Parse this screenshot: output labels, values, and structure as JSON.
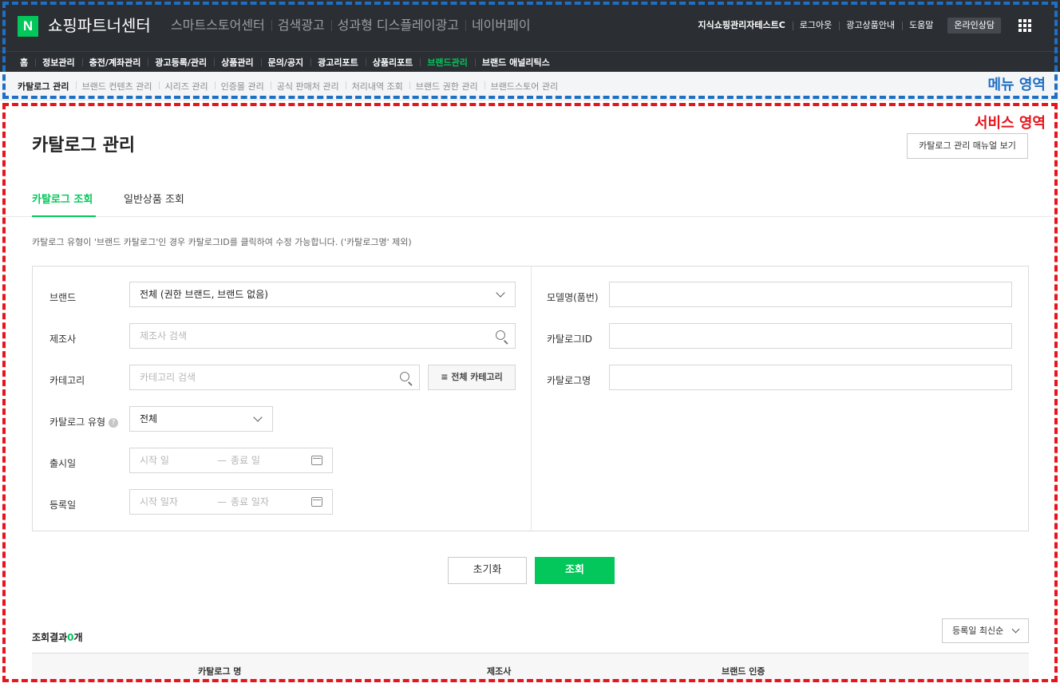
{
  "header": {
    "logo_mark": "N",
    "logo_text": "쇼핑파트너센터",
    "links": [
      "스마트스토어센터",
      "검색광고",
      "성과형 디스플레이광고",
      "네이버페이"
    ],
    "user": "지식쇼핑관리자테스트C",
    "user_links": [
      "로그아웃",
      "광고상품안내",
      "도움말"
    ],
    "consult": "온라인상담"
  },
  "main_menu": [
    {
      "label": "홈"
    },
    {
      "label": "정보관리"
    },
    {
      "label": "충전/계좌관리"
    },
    {
      "label": "광고등록/관리"
    },
    {
      "label": "상품관리"
    },
    {
      "label": "문의/공지"
    },
    {
      "label": "광고리포트"
    },
    {
      "label": "상품리포트"
    },
    {
      "label": "브랜드관리"
    },
    {
      "label": "브랜드 애널리틱스"
    }
  ],
  "sub_menu": [
    {
      "label": "카탈로그 관리"
    },
    {
      "label": "브랜드 컨텐츠 관리"
    },
    {
      "label": "시리즈 관리"
    },
    {
      "label": "인증몰 관리"
    },
    {
      "label": "공식 판매처 관리"
    },
    {
      "label": "처리내역 조회"
    },
    {
      "label": "브랜드 권한 관리"
    },
    {
      "label": "브랜드스토어 관리"
    }
  ],
  "annotations": {
    "menu_region": "메뉴 영역",
    "service_region": "서비스 영역",
    "menu_color": "#1f6fc4",
    "service_color": "#e8141c"
  },
  "page": {
    "title": "카탈로그 관리",
    "manual_button": "카탈로그 관리 매뉴얼 보기",
    "tabs": [
      "카탈로그 조회",
      "일반상품 조회"
    ],
    "notice": "카탈로그 유형이 '브랜드 카탈로그'인 경우 카탈로그ID를 클릭하여 수정 가능합니다. ('카탈로그명' 제외)"
  },
  "form": {
    "brand_label": "브랜드",
    "brand_value": "전체 (권한 브랜드, 브랜드 없음)",
    "maker_label": "제조사",
    "maker_placeholder": "제조사 검색",
    "category_label": "카테고리",
    "category_placeholder": "카테고리 검색",
    "all_category_button": "≡ 전체 카테고리",
    "type_label": "카탈로그 유형",
    "type_value": "전체",
    "release_label": "출시일",
    "release_start": "시작 일",
    "release_end": "종료 일",
    "reg_label": "등록일",
    "reg_start": "시작 일자",
    "reg_end": "종료 일자",
    "model_label": "모델명(품번)",
    "catalog_id_label": "카탈로그ID",
    "catalog_name_label": "카탈로그명",
    "date_sep": "—",
    "help_mark": "?"
  },
  "actions": {
    "reset": "초기화",
    "search": "조회"
  },
  "results": {
    "label": "조회결과",
    "count": "0",
    "unit": "개",
    "sort": "등록일 최신순",
    "columns": [
      "카탈로그 명",
      "제조사",
      "브랜드 인증"
    ]
  },
  "colors": {
    "accent": "#03c75a",
    "header_bg": "#2b2e33"
  }
}
